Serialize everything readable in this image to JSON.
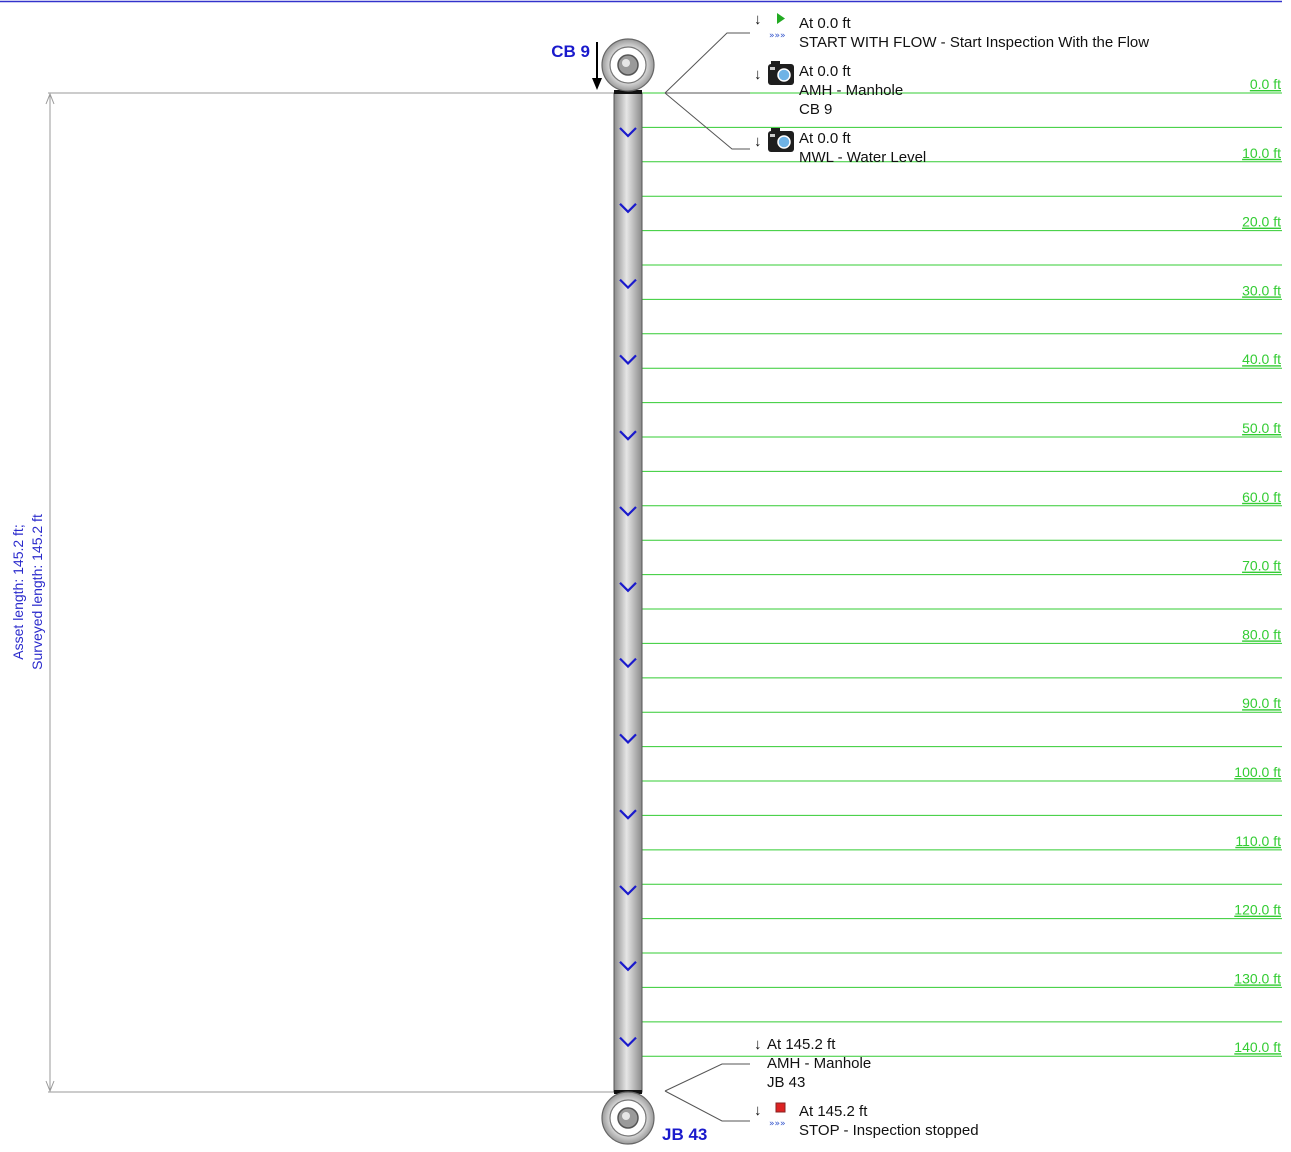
{
  "colors": {
    "top_border": "#3333cc",
    "grid_line": "#33cc33",
    "distance_label": "#33cc33",
    "node_label": "#1a1acc",
    "length_label": "#2a2acc",
    "flow_chevron": "#1a1acc",
    "pipe_fill": "#d0d0d0",
    "observation_text": "#111111"
  },
  "asset": {
    "upstream_node": "CB 9",
    "downstream_node": "JB 43",
    "length_line1": "Asset length: 145.2 ft;",
    "length_line2": "Surveyed length: 145.2 ft",
    "total_length_ft": 145.2,
    "flow_direction": "down"
  },
  "distance_scale": {
    "unit": "ft",
    "marks": [
      {
        "value": 0,
        "label": "0.0 ft"
      },
      {
        "value": 10,
        "label": "10.0 ft"
      },
      {
        "value": 20,
        "label": "20.0 ft"
      },
      {
        "value": 30,
        "label": "30.0 ft"
      },
      {
        "value": 40,
        "label": "40.0 ft"
      },
      {
        "value": 50,
        "label": "50.0 ft"
      },
      {
        "value": 60,
        "label": "60.0 ft"
      },
      {
        "value": 70,
        "label": "70.0 ft"
      },
      {
        "value": 80,
        "label": "80.0 ft"
      },
      {
        "value": 90,
        "label": "90.0 ft"
      },
      {
        "value": 100,
        "label": "100.0 ft"
      },
      {
        "value": 110,
        "label": "110.0 ft"
      },
      {
        "value": 120,
        "label": "120.0 ft"
      },
      {
        "value": 130,
        "label": "130.0 ft"
      },
      {
        "value": 140,
        "label": "140.0 ft"
      }
    ]
  },
  "observations": [
    {
      "distance": 0.0,
      "lines": [
        "At 0.0 ft",
        "START WITH FLOW - Start Inspection With the Flow"
      ],
      "icon": "start-flow-icon"
    },
    {
      "distance": 0.0,
      "lines": [
        "At 0.0 ft",
        "AMH - Manhole",
        "CB 9"
      ],
      "icon": "camera-icon"
    },
    {
      "distance": 0.0,
      "lines": [
        "At 0.0 ft",
        "MWL - Water Level"
      ],
      "icon": "camera-icon"
    },
    {
      "distance": 145.2,
      "lines": [
        "At 145.2 ft",
        "AMH - Manhole",
        "JB 43"
      ],
      "icon": ""
    },
    {
      "distance": 145.2,
      "lines": [
        "At 145.2 ft",
        "STOP - Inspection stopped"
      ],
      "icon": "stop-flow-icon"
    }
  ]
}
